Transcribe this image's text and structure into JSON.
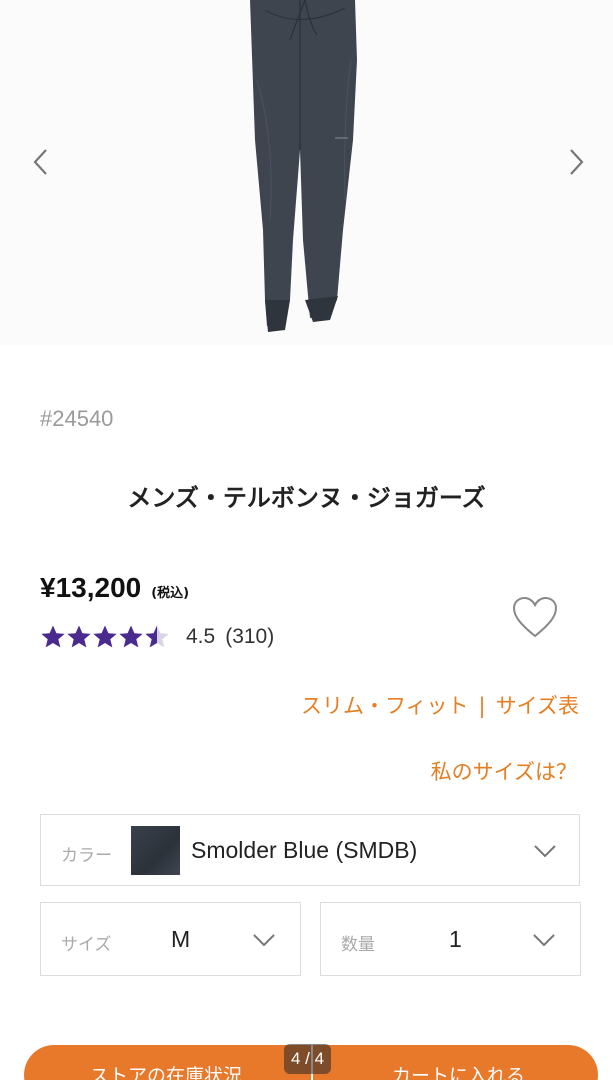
{
  "gallery": {
    "prev_icon": "chevron-left-icon",
    "next_icon": "chevron-right-icon",
    "page_indicator": "4 / 4"
  },
  "product": {
    "id": "#24540",
    "title": "メンズ・テルボンヌ・ジョガーズ",
    "price": "¥13,200",
    "tax_note": "(税込)",
    "rating": 4.5,
    "rating_text": "4.5",
    "review_count": "(310)",
    "star_color": "#4b2a8f",
    "wishlist_icon": "heart-outline-icon"
  },
  "links": {
    "fit": "スリム・フィット",
    "separator": "|",
    "size_chart": "サイズ表",
    "my_size": "私のサイズは？",
    "color": "#e67e22"
  },
  "selectors": {
    "color": {
      "label": "カラー",
      "value": "Smolder Blue (SMDB)"
    },
    "size": {
      "label": "サイズ",
      "value": "M"
    },
    "quantity": {
      "label": "数量",
      "value": "1"
    }
  },
  "actions": {
    "store_stock": "ストアの在庫状況",
    "add_to_cart": "カートに入れる",
    "bar_color": "#e8782a"
  }
}
